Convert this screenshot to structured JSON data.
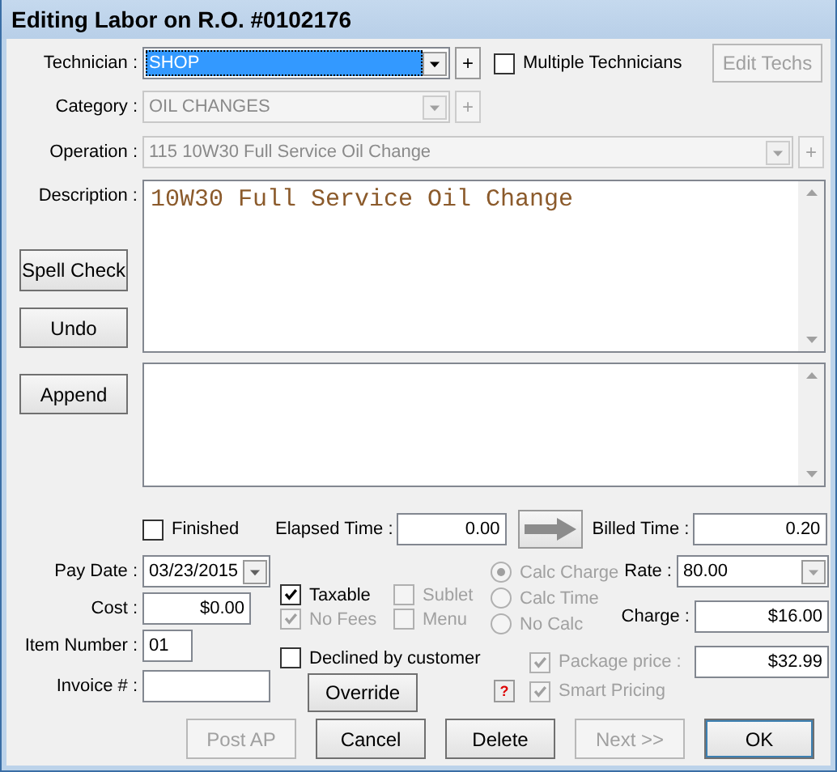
{
  "window": {
    "title": "Editing Labor on R.O. #0102176"
  },
  "technician": {
    "label": "Technician :",
    "value": "SHOP",
    "focused": true,
    "add": "+",
    "add_disabled": false
  },
  "multiple_technicians": {
    "label": "Multiple Technicians",
    "checked": false
  },
  "edit_techs": {
    "label": "Edit Techs",
    "disabled": true
  },
  "category": {
    "label": "Category :",
    "value": "OIL CHANGES",
    "disabled": true,
    "add": "+",
    "add_disabled": true
  },
  "operation": {
    "label": "Operation :",
    "value": "115  10W30 Full Service Oil Change",
    "disabled": true,
    "add": "+",
    "add_disabled": true
  },
  "description": {
    "label": "Description :",
    "value": "10W30 Full Service Oil Change"
  },
  "side_buttons": [
    "Spell Check",
    "Undo"
  ],
  "append_button": "Append",
  "finished": {
    "label": "Finished",
    "checked": false
  },
  "elapsed_time": {
    "label": "Elapsed Time :",
    "value": "0.00"
  },
  "billed_time": {
    "label": "Billed Time :",
    "value": "0.20"
  },
  "pay_date": {
    "label": "Pay Date :",
    "value": "03/23/2015"
  },
  "cost": {
    "label": "Cost :",
    "value": "$0.00"
  },
  "item_number": {
    "label": "Item Number :",
    "value": "01"
  },
  "invoice": {
    "label": "Invoice # :"
  },
  "options": [
    {
      "label": "Taxable",
      "checked": true,
      "disabled": false
    },
    {
      "label": "Sublet",
      "checked": false,
      "disabled": true
    },
    {
      "label": "No Fees",
      "checked": true,
      "disabled": true
    },
    {
      "label": "Menu",
      "checked": false,
      "disabled": true
    }
  ],
  "declined": {
    "label": "Declined by customer",
    "checked": false
  },
  "override_button": "Override",
  "calc_modes": [
    {
      "label": "Calc Charge",
      "selected": true
    },
    {
      "label": "Calc Time",
      "selected": false
    },
    {
      "label": "No Calc",
      "selected": false
    }
  ],
  "rate": {
    "label": "Rate :",
    "value": "80.00"
  },
  "charge": {
    "label": "Charge :",
    "value": "$16.00"
  },
  "package_price": {
    "label": "Package price :",
    "checked": true,
    "disabled": true,
    "value": "$32.99"
  },
  "help_icon": "?",
  "smart_pricing": {
    "label": "Smart Pricing",
    "checked": true,
    "disabled": true
  },
  "buttons": [
    {
      "label": "Post AP",
      "disabled": true
    },
    {
      "label": "Cancel",
      "disabled": false
    },
    {
      "label": "Delete",
      "disabled": false
    },
    {
      "label": "Next >>",
      "disabled": true
    },
    {
      "label": "OK",
      "disabled": false
    }
  ]
}
